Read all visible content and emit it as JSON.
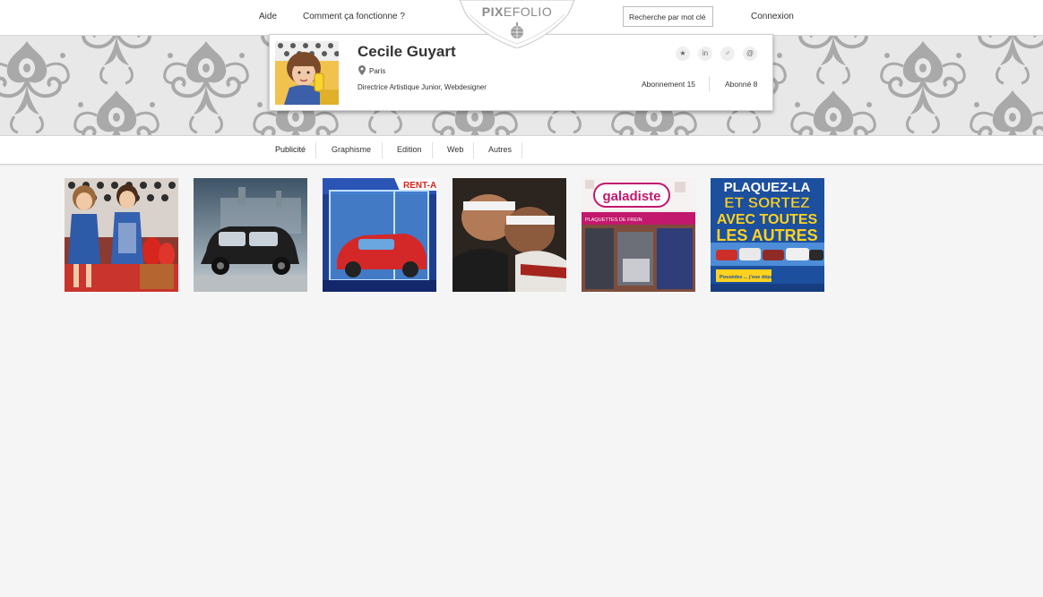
{
  "nav": {
    "help_label": "Aide",
    "how_label": "Comment ça fonctionne ?",
    "search_placeholder": "Recherche par mot clé",
    "login_label": "Connexion"
  },
  "logo": {
    "brand_bold": "PIX",
    "brand_light": "EFOLIO"
  },
  "profile": {
    "name": "Cecile Guyart",
    "city": "Paris",
    "role": "Directrice Artistique Junior, Webdesigner",
    "following_label": "Abonnement 15",
    "followers_label": "Abonné 8",
    "social": [
      {
        "icon": "star-icon",
        "glyph": "★"
      },
      {
        "icon": "linkedin-icon",
        "glyph": "in"
      },
      {
        "icon": "male-icon",
        "glyph": "♂"
      },
      {
        "icon": "at-icon",
        "glyph": "@"
      }
    ]
  },
  "tabs": [
    "Publicité",
    "Graphisme",
    "Edition",
    "Web",
    "Autres"
  ],
  "active_tab": "Publicité",
  "thumbnails": {
    "t3_text": "RENT-A",
    "t5_brand": "galadiste",
    "t5_sign": "PLAQUETTES DE FREIN",
    "t6_headline_1": "PLAQUEZ-LA",
    "t6_headline_2": "ET SORTEZ",
    "t6_headline_3": "AVEC TOUTES",
    "t6_headline_4": "LES AUTRES",
    "t6_badge": "Possédez ... j'ose dépassé !"
  },
  "colors": {
    "banner_bg": "#e8e8e8",
    "damask": "#a9a9a9",
    "page_bg": "#f5f5f5",
    "t6_blue": "#1c4f9e",
    "t6_yellow": "#ffd21f",
    "t5_magenta": "#c2186e"
  }
}
